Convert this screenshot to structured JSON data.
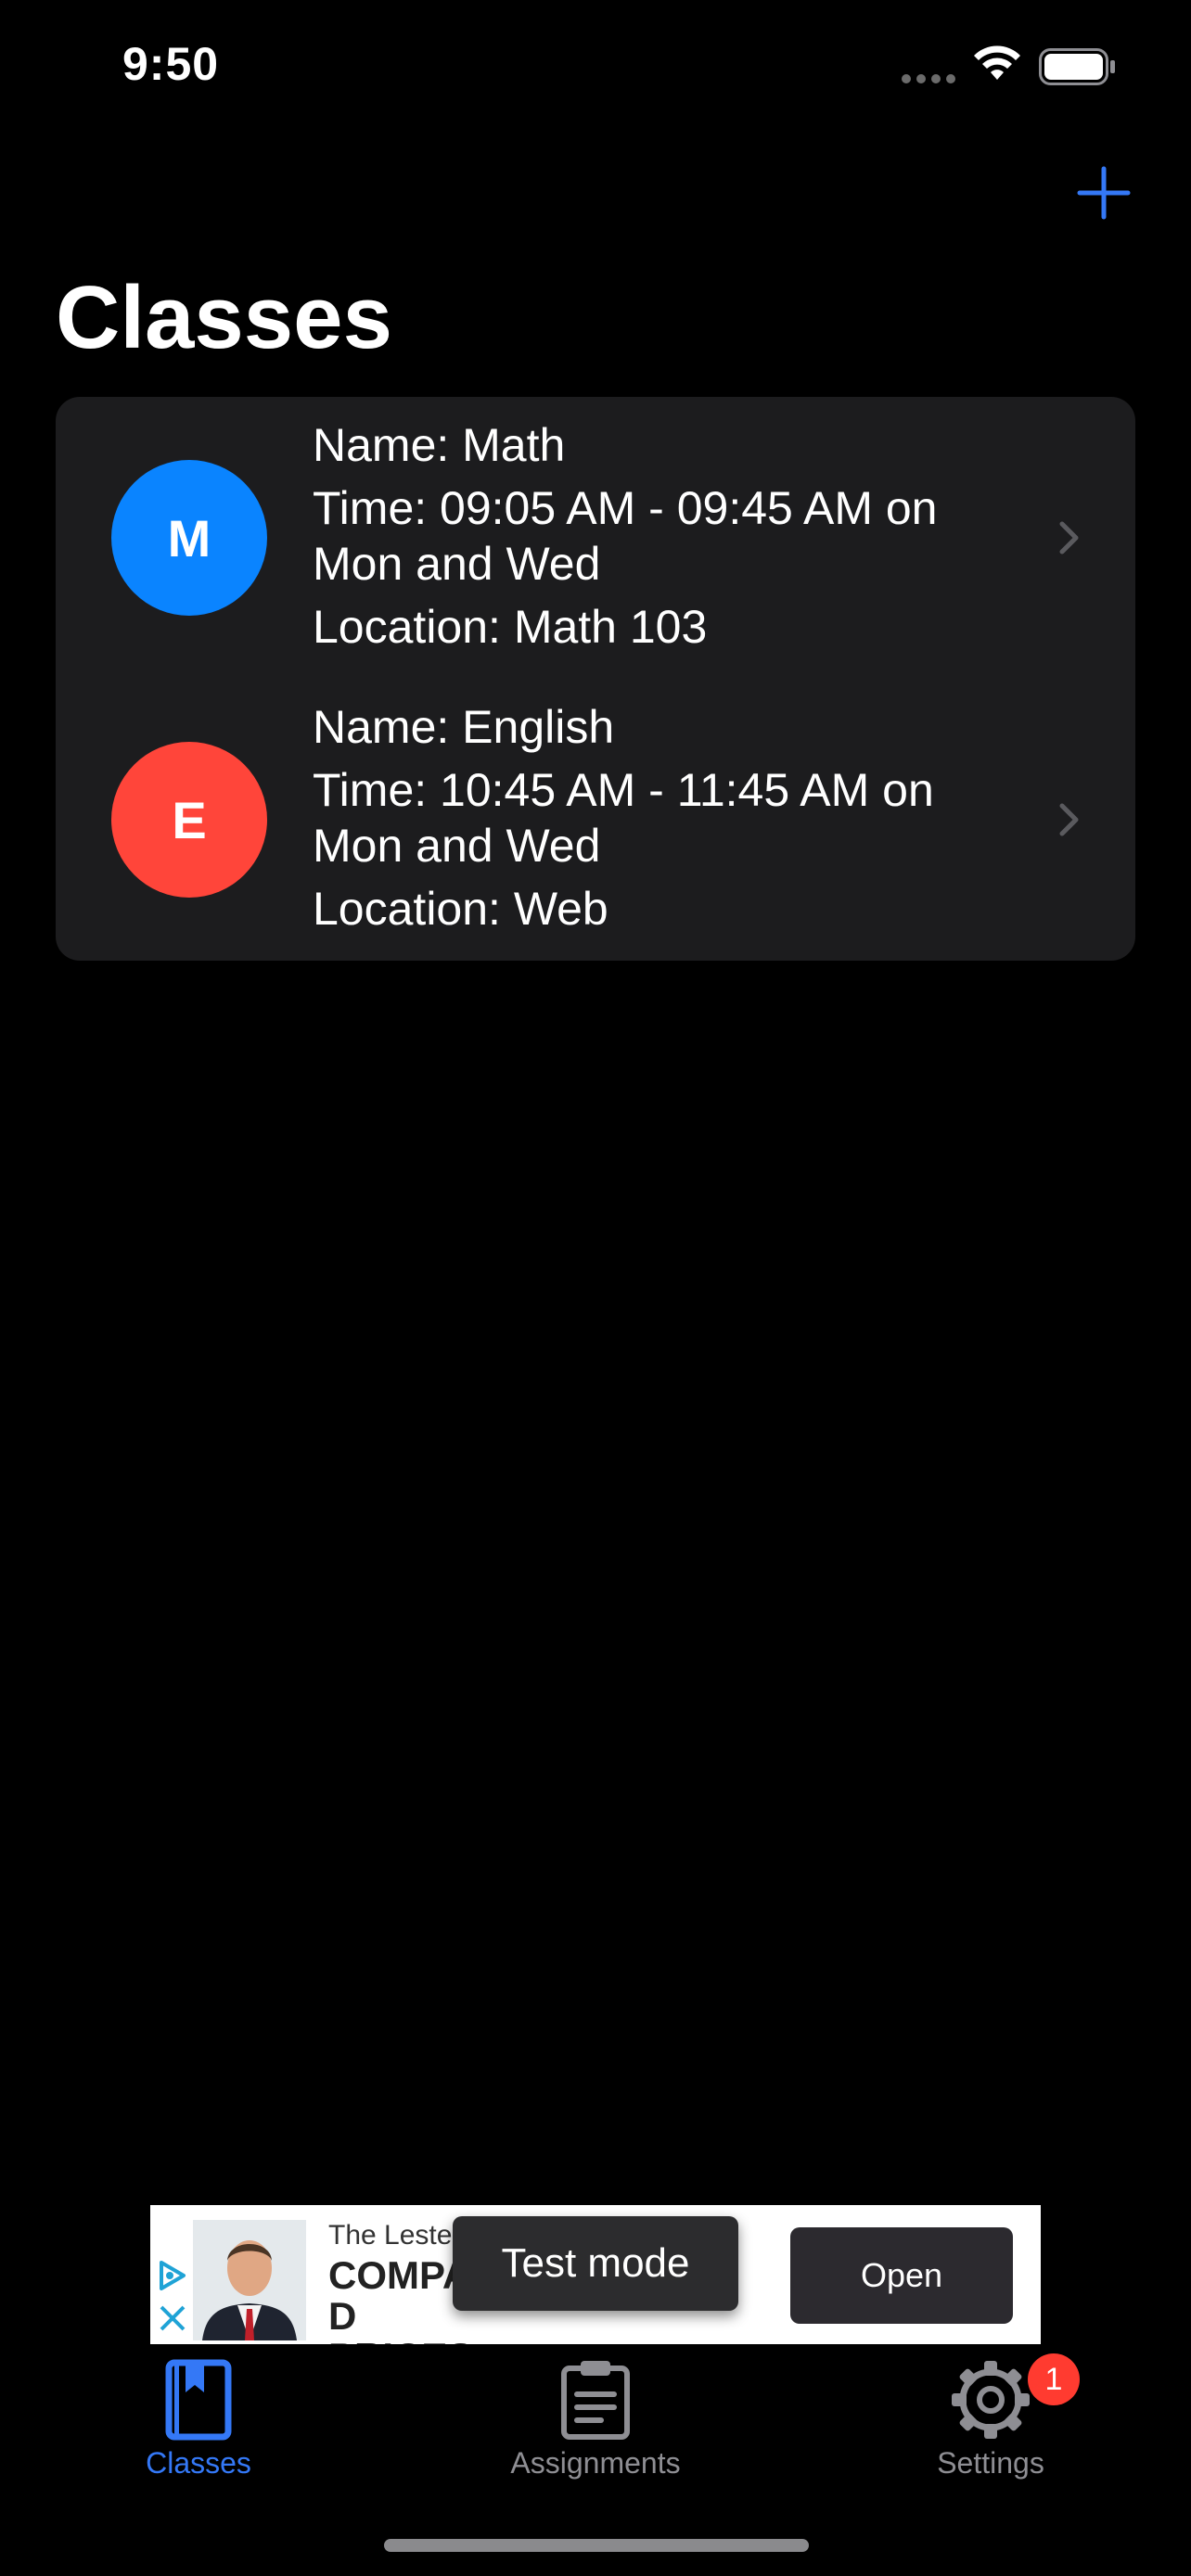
{
  "status_bar": {
    "time": "9:50"
  },
  "nav": {
    "title": "Classes",
    "add_icon": "plus-icon"
  },
  "colors": {
    "accent": "#3478f6",
    "math_avatar": "#0a84ff",
    "english_avatar": "#ff453a",
    "badge": "#ff3b30",
    "row_background": "#1c1c1e"
  },
  "classes": [
    {
      "initial": "M",
      "name": "Name: Math",
      "time_line1": "Time: 09:05 AM - 09:45 AM on",
      "time_line2": "Mon and Wed",
      "location": "Location: Math 103"
    },
    {
      "initial": "E",
      "name": "Name: English",
      "time_line1": "Time: 10:45 AM - 11:45 AM on",
      "time_line2": "Mon and Wed",
      "location": "Location: Web"
    }
  ],
  "ad": {
    "brand": "The Lester",
    "headline_line1": "COMPA",
    "headline_suffix": "D",
    "headline_line2": "PRICES",
    "open_label": "Open",
    "test_mode_label": "Test mode"
  },
  "tab_bar": {
    "tabs": [
      {
        "label": "Classes",
        "icon": "bookmark-book-icon",
        "selected": true
      },
      {
        "label": "Assignments",
        "icon": "clipboard-icon",
        "selected": false
      },
      {
        "label": "Settings",
        "icon": "gear-icon",
        "selected": false,
        "badge": "1"
      }
    ]
  }
}
